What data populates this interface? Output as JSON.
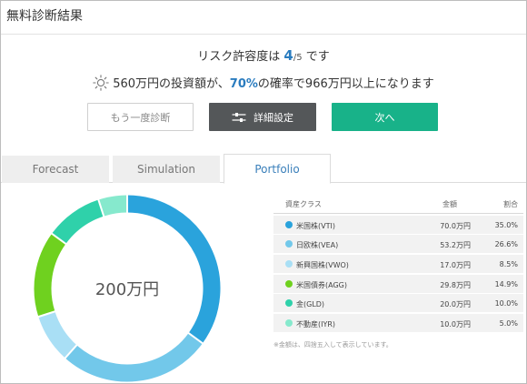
{
  "header": {
    "title": "無料診断結果"
  },
  "summary": {
    "risk_prefix": "リスク許容度は",
    "risk_value": "4",
    "risk_separator": "/",
    "risk_max": "5",
    "risk_suffix": "です",
    "prob_part1": "560万円の投資額が、",
    "prob_highlight": "70%",
    "prob_part2": "の確率で966万円以上になります"
  },
  "buttons": {
    "retry": "もう一度診断",
    "detail": "詳細設定",
    "next": "次へ"
  },
  "tabs": [
    {
      "label": "Forecast"
    },
    {
      "label": "Simulation"
    },
    {
      "label": "Portfolio"
    }
  ],
  "active_tab": "Portfolio",
  "portfolio": {
    "total": "200万円",
    "headers": {
      "class": "資産クラス",
      "amount": "金額",
      "ratio": "割合"
    },
    "rows": [
      {
        "name": "米国株(VTI)",
        "amount": "70.0万円",
        "ratio": "35.0%",
        "value": 35.0,
        "color": "#2aa3dc"
      },
      {
        "name": "日欧株(VEA)",
        "amount": "53.2万円",
        "ratio": "26.6%",
        "value": 26.6,
        "color": "#72c8ea"
      },
      {
        "name": "新興国株(VWO)",
        "amount": "17.0万円",
        "ratio": "8.5%",
        "value": 8.5,
        "color": "#a9dff5"
      },
      {
        "name": "米国債券(AGG)",
        "amount": "29.8万円",
        "ratio": "14.9%",
        "value": 14.9,
        "color": "#6fd11f"
      },
      {
        "name": "金(GLD)",
        "amount": "20.0万円",
        "ratio": "10.0%",
        "value": 10.0,
        "color": "#2fd1aa"
      },
      {
        "name": "不動産(IYR)",
        "amount": "10.0万円",
        "ratio": "5.0%",
        "value": 5.0,
        "color": "#86e9cd"
      }
    ],
    "note": "※金額は、四捨五入して表示しています。"
  }
}
